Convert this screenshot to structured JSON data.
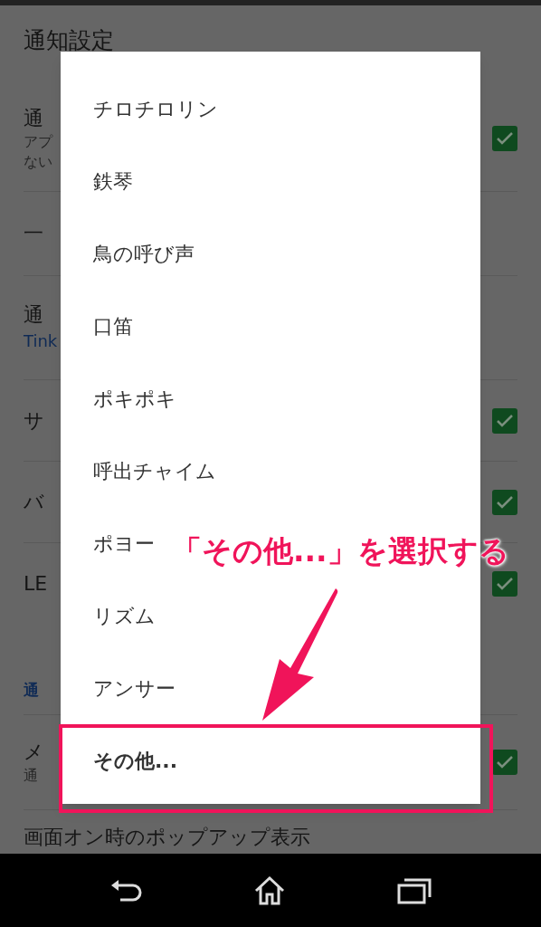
{
  "screen_title": "通知設定",
  "settings": [
    {
      "kind": "toggle",
      "title": "通",
      "subtitle_lines": [
        "アプ",
        "ない"
      ],
      "checked": true
    },
    {
      "kind": "plain",
      "title": "一"
    },
    {
      "kind": "value",
      "title": "通",
      "value": "Tink"
    },
    {
      "kind": "toggle",
      "title": "サ",
      "checked": true
    },
    {
      "kind": "toggle",
      "title": "バ",
      "checked": true
    },
    {
      "kind": "toggle",
      "title": "LE",
      "checked": true
    },
    {
      "kind": "section",
      "title": "通"
    },
    {
      "kind": "toggle",
      "title": "メ",
      "subtitle_lines": [
        "通"
      ],
      "checked": true
    },
    {
      "kind": "plain",
      "title": "画面オン時のポップアップ表示"
    }
  ],
  "dialog": {
    "options": [
      {
        "label": "チロチロリン",
        "highlighted": false
      },
      {
        "label": "鉄琴",
        "highlighted": false
      },
      {
        "label": "鳥の呼び声",
        "highlighted": false
      },
      {
        "label": "口笛",
        "highlighted": false
      },
      {
        "label": "ポキポキ",
        "highlighted": false
      },
      {
        "label": "呼出チャイム",
        "highlighted": false
      },
      {
        "label": "ポヨー",
        "highlighted": false
      },
      {
        "label": "リズム",
        "highlighted": false
      },
      {
        "label": "アンサー",
        "highlighted": false
      },
      {
        "label": "その他...",
        "highlighted": true
      }
    ]
  },
  "annotation": {
    "caption": "「その他...」を選択する"
  }
}
